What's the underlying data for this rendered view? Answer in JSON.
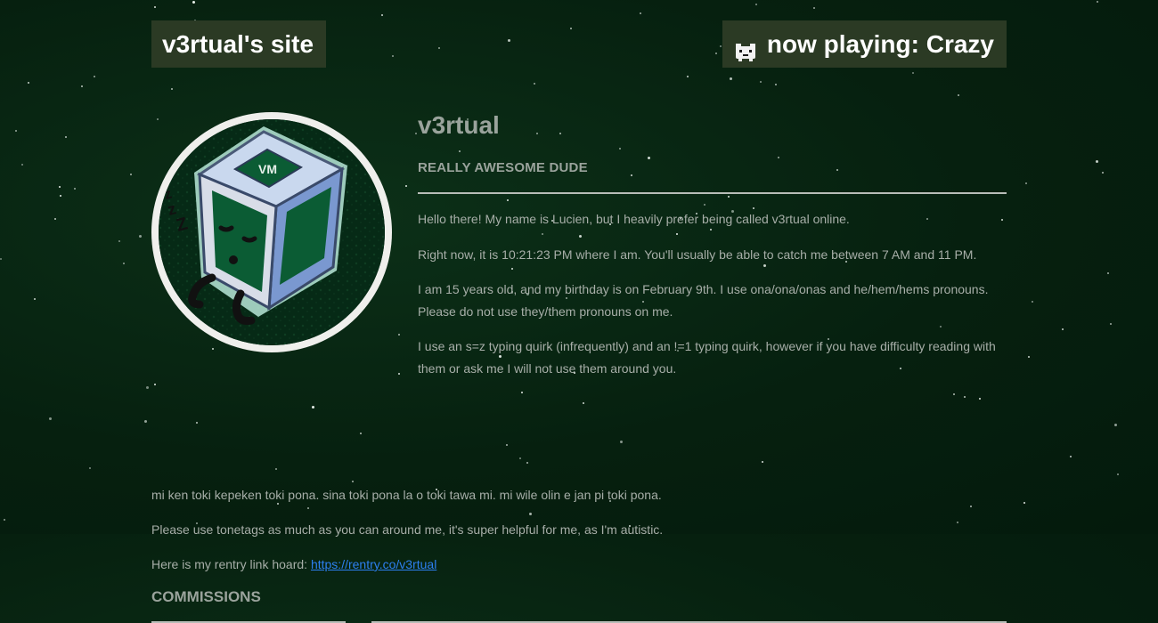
{
  "header": {
    "site_title": "v3rtual's site",
    "now_playing": "now playing: Crazy",
    "now_playing_icon": "cat-face-icon"
  },
  "profile": {
    "name": "v3rtual",
    "subtitle": "REALLY AWESOME DUDE",
    "avatar_icon": "sleepy-cube-icon",
    "avatar_colors": {
      "ring": "#efefec",
      "cube_face": "#0b5c34",
      "cube_side": "#7a98d0",
      "cube_top": "#c9d8ee"
    },
    "paragraphs": [
      "Hello there! My name is Lucien, but I heavily prefer being called v3rtual online.",
      "Right now, it is 10:21:23 PM where I am. You'll usually be able to catch me between 7 AM and 11 PM.",
      "I am 15 years old, and my birthday is on February 9th. I use ona/ona/onas and he/hem/hems pronouns. Please do not use they/them pronouns on me.",
      "I use an s=z typing quirk (infrequently) and an !=1 typing quirk, however if you have difficulty reading with them or ask me I will not use them around you."
    ]
  },
  "lower": {
    "toki_pona": "mi ken toki kepeken toki pona. sina toki pona la o toki tawa mi. mi wile olin e jan pi toki pona.",
    "tonetags": "Please use tonetags as much as you can around me, it's super helpful for me, as I'm autistic.",
    "rentry_prefix": "Here is my rentry link hoard: ",
    "rentry_link": "https://rentry.co/v3rtual",
    "commissions_heading": "COMMISSIONS"
  },
  "colors": {
    "background": "#06200f",
    "header_box": "#2b3a24",
    "text": "#a7aea8",
    "link": "#2d7ff0"
  }
}
